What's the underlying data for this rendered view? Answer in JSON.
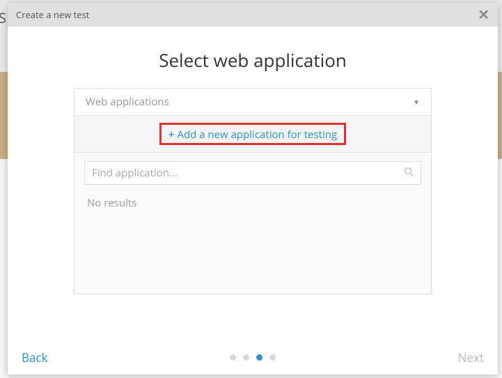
{
  "header": {
    "title": "Create a new test"
  },
  "main": {
    "heading": "Select web application",
    "dropdown_label": "Web applications",
    "add_link": "Add a new application for testing",
    "search_placeholder": "Find application...",
    "no_results": "No results"
  },
  "footer": {
    "back": "Back",
    "next": "Next",
    "steps": {
      "total": 4,
      "current": 3
    }
  }
}
